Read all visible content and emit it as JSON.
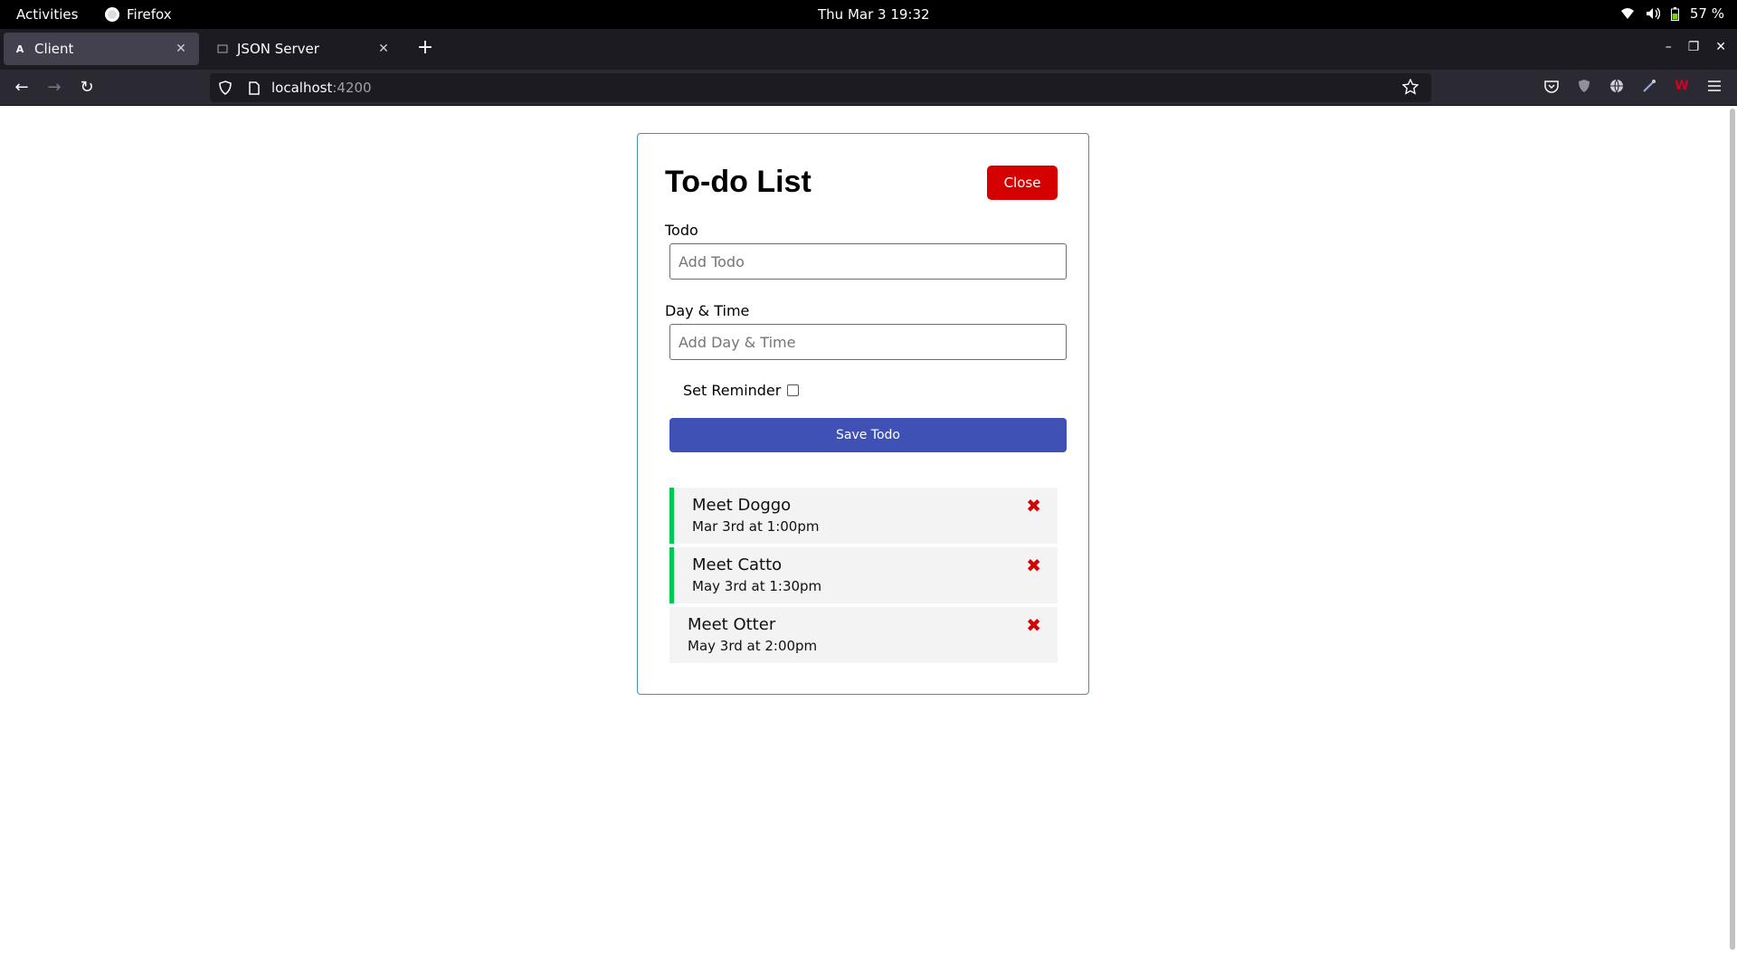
{
  "system": {
    "activities": "Activities",
    "app_name": "Firefox",
    "clock": "Thu Mar 3  19:32",
    "battery": "57 %"
  },
  "browser": {
    "tabs": [
      {
        "label": "Client",
        "favicon": "A"
      },
      {
        "label": "JSON Server",
        "favicon": ""
      }
    ],
    "url_host": "localhost",
    "url_port": ":4200"
  },
  "app": {
    "title": "To-do List",
    "close_label": "Close",
    "todo_label": "Todo",
    "todo_placeholder": "Add Todo",
    "daytime_label": "Day & Time",
    "daytime_placeholder": "Add Day & Time",
    "reminder_label": "Set Reminder",
    "save_label": "Save Todo",
    "todos": [
      {
        "title": "Meet Doggo",
        "date": "Mar 3rd at 1:00pm",
        "reminder": true
      },
      {
        "title": "Meet Catto",
        "date": "May 3rd at 1:30pm",
        "reminder": true
      },
      {
        "title": "Meet Otter",
        "date": "May 3rd at 2:00pm",
        "reminder": false
      }
    ],
    "delete_glyph": "✖"
  },
  "colors": {
    "close_button": "#d50000",
    "save_button": "#3f51b5",
    "reminder_border": "#00c853",
    "card_border": "#4b8fb1"
  }
}
